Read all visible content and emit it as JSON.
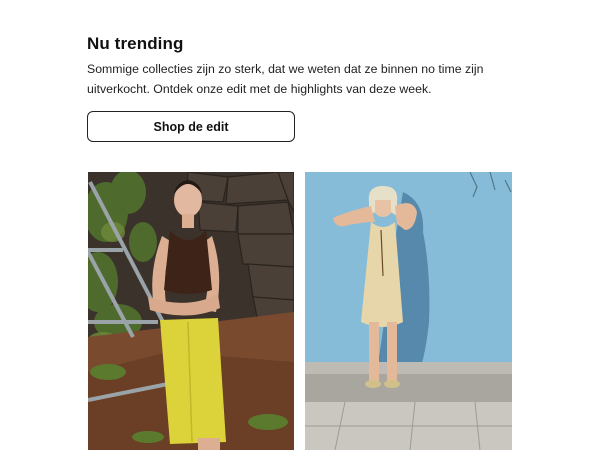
{
  "promo": {
    "title": "Nu trending",
    "description": "Sommige collecties zijn zo sterk, dat we weten dat ze binnen no time zijn uitverkocht. Ontdek onze edit met de highlights van deze week.",
    "cta_label": "Shop de edit"
  },
  "colors": {
    "text": "#1a1a1a",
    "button_border": "#222222",
    "background": "#ffffff",
    "left_photo_wall": "#3a3029",
    "left_photo_skirt": "#dcd33c",
    "right_photo_wall": "#86bcd9",
    "right_photo_dress": "#e4d4a8"
  },
  "images": [
    {
      "name": "model-brown-top-yellow-skirt"
    },
    {
      "name": "model-beige-dress-blue-wall"
    }
  ]
}
